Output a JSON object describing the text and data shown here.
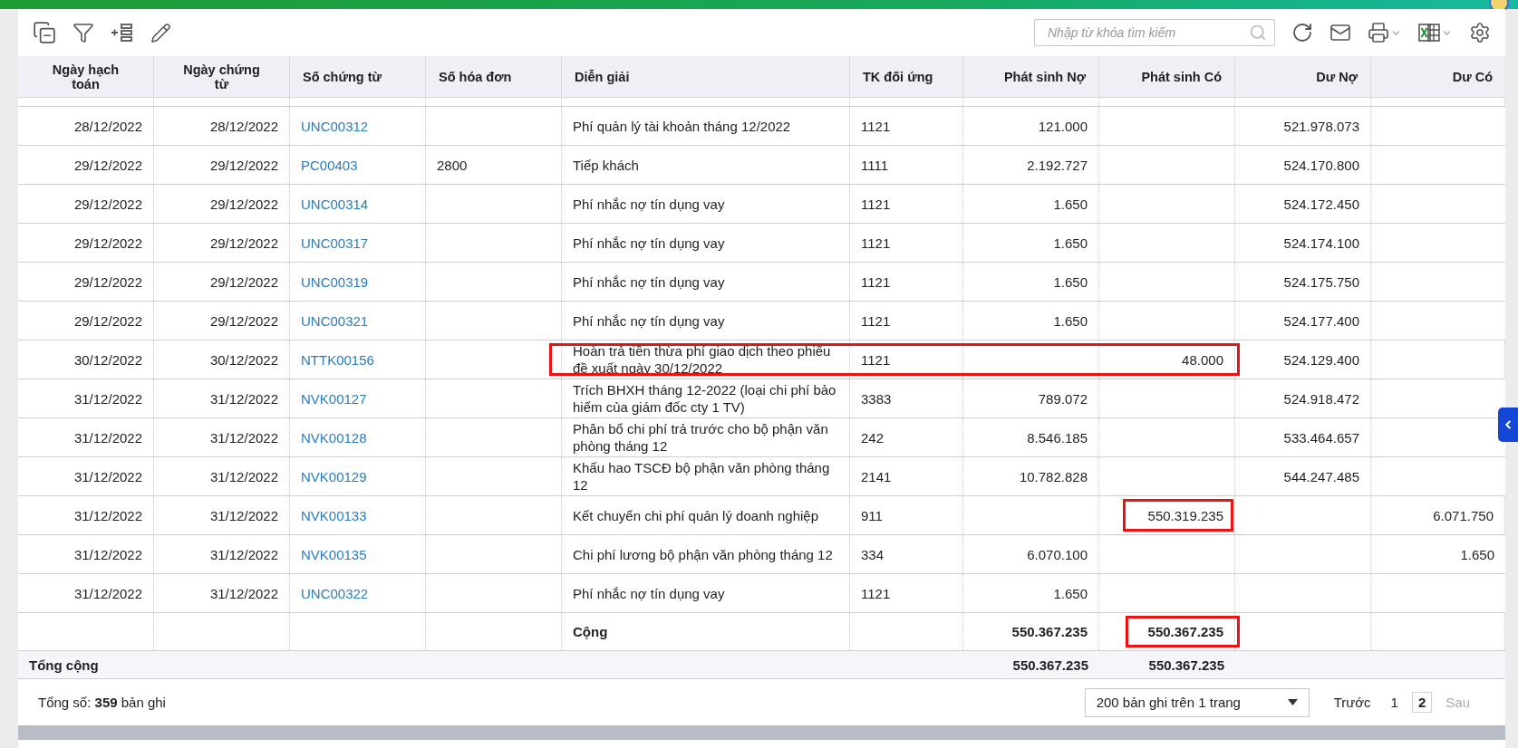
{
  "toolbar": {
    "search": {
      "placeholder": "Nhập từ khóa tìm kiếm"
    }
  },
  "table": {
    "columns": [
      "Ngày hạch toán",
      "Ngày chứng từ",
      "Số chứng từ",
      "Số hóa đơn",
      "Diễn giải",
      "TK đối ứng",
      "Phát sinh Nợ",
      "Phát sinh Có",
      "Dư Nợ",
      "Dư Có"
    ],
    "rows": [
      {
        "posting_date": "28/12/2022",
        "voucher_date": "28/12/2022",
        "voucher_no": "UNC00312",
        "invoice_no": "",
        "description": "Phí quản lý tài khoản tháng 12/2022",
        "account": "1121",
        "debit": "121.000",
        "credit": "",
        "debit_balance": "521.978.073",
        "credit_balance": "",
        "span_outlined": false,
        "credit_outlined": false
      },
      {
        "posting_date": "29/12/2022",
        "voucher_date": "29/12/2022",
        "voucher_no": "PC00403",
        "invoice_no": "2800",
        "description": "Tiếp khách",
        "account": "1111",
        "debit": "2.192.727",
        "credit": "",
        "debit_balance": "524.170.800",
        "credit_balance": "",
        "span_outlined": false,
        "credit_outlined": false
      },
      {
        "posting_date": "29/12/2022",
        "voucher_date": "29/12/2022",
        "voucher_no": "UNC00314",
        "invoice_no": "",
        "description": "Phí nhắc nợ tín dụng vay",
        "account": "1121",
        "debit": "1.650",
        "credit": "",
        "debit_balance": "524.172.450",
        "credit_balance": "",
        "span_outlined": false,
        "credit_outlined": false
      },
      {
        "posting_date": "29/12/2022",
        "voucher_date": "29/12/2022",
        "voucher_no": "UNC00317",
        "invoice_no": "",
        "description": "Phí nhắc nợ tín dụng vay",
        "account": "1121",
        "debit": "1.650",
        "credit": "",
        "debit_balance": "524.174.100",
        "credit_balance": "",
        "span_outlined": false,
        "credit_outlined": false
      },
      {
        "posting_date": "29/12/2022",
        "voucher_date": "29/12/2022",
        "voucher_no": "UNC00319",
        "invoice_no": "",
        "description": "Phí nhắc nợ tín dụng vay",
        "account": "1121",
        "debit": "1.650",
        "credit": "",
        "debit_balance": "524.175.750",
        "credit_balance": "",
        "span_outlined": false,
        "credit_outlined": false
      },
      {
        "posting_date": "29/12/2022",
        "voucher_date": "29/12/2022",
        "voucher_no": "UNC00321",
        "invoice_no": "",
        "description": "Phí nhắc nợ tín dụng vay",
        "account": "1121",
        "debit": "1.650",
        "credit": "",
        "debit_balance": "524.177.400",
        "credit_balance": "",
        "span_outlined": false,
        "credit_outlined": false
      },
      {
        "posting_date": "30/12/2022",
        "voucher_date": "30/12/2022",
        "voucher_no": "NTTK00156",
        "invoice_no": "",
        "description": "Hoàn trả tiền thừa phí giao dịch theo phiếu đề xuất ngày 30/12/2022",
        "account": "1121",
        "debit": "",
        "credit": "48.000",
        "debit_balance": "524.129.400",
        "credit_balance": "",
        "span_outlined": true,
        "credit_outlined": false
      },
      {
        "posting_date": "31/12/2022",
        "voucher_date": "31/12/2022",
        "voucher_no": "NVK00127",
        "invoice_no": "",
        "description": "Trích BHXH tháng 12-2022 (loại chi phí bảo hiểm của giám đốc cty 1 TV)",
        "account": "3383",
        "debit": "789.072",
        "credit": "",
        "debit_balance": "524.918.472",
        "credit_balance": "",
        "span_outlined": false,
        "credit_outlined": false
      },
      {
        "posting_date": "31/12/2022",
        "voucher_date": "31/12/2022",
        "voucher_no": "NVK00128",
        "invoice_no": "",
        "description": "Phân bổ chi phí trả trước cho bộ phận văn phòng tháng 12",
        "account": "242",
        "debit": "8.546.185",
        "credit": "",
        "debit_balance": "533.464.657",
        "credit_balance": "",
        "span_outlined": false,
        "credit_outlined": false
      },
      {
        "posting_date": "31/12/2022",
        "voucher_date": "31/12/2022",
        "voucher_no": "NVK00129",
        "invoice_no": "",
        "description": "Khấu hao TSCĐ bộ phận văn phòng tháng 12",
        "account": "2141",
        "debit": "10.782.828",
        "credit": "",
        "debit_balance": "544.247.485",
        "credit_balance": "",
        "span_outlined": false,
        "credit_outlined": false
      },
      {
        "posting_date": "31/12/2022",
        "voucher_date": "31/12/2022",
        "voucher_no": "NVK00133",
        "invoice_no": "",
        "description": "Kết chuyển chi phí quản lý doanh nghiệp",
        "account": "911",
        "debit": "",
        "credit": "550.319.235",
        "debit_balance": "",
        "credit_balance": "6.071.750",
        "span_outlined": false,
        "credit_outlined": true
      },
      {
        "posting_date": "31/12/2022",
        "voucher_date": "31/12/2022",
        "voucher_no": "NVK00135",
        "invoice_no": "",
        "description": "Chi phí lương bộ phận văn phòng tháng 12",
        "account": "334",
        "debit": "6.070.100",
        "credit": "",
        "debit_balance": "",
        "credit_balance": "1.650",
        "span_outlined": false,
        "credit_outlined": false
      },
      {
        "posting_date": "31/12/2022",
        "voucher_date": "31/12/2022",
        "voucher_no": "UNC00322",
        "invoice_no": "",
        "description": "Phí nhắc nợ tín dụng vay",
        "account": "1121",
        "debit": "1.650",
        "credit": "",
        "debit_balance": "",
        "credit_balance": "",
        "span_outlined": false,
        "credit_outlined": false
      }
    ],
    "subtotal": {
      "label": "Cộng",
      "debit": "550.367.235",
      "credit": "550.367.235",
      "credit_outlined": true
    },
    "grand_total": {
      "label": "Tổng cộng",
      "debit": "550.367.235",
      "credit": "550.367.235"
    }
  },
  "footer": {
    "total_label": "Tổng số:",
    "total_count": "359",
    "total_unit": "bản ghi",
    "page_size": "200 bản ghi trên 1 trang",
    "prev": "Trước",
    "pages": [
      {
        "label": "1",
        "selected": false
      },
      {
        "label": "2",
        "selected": true
      }
    ],
    "next": "Sau",
    "next_disabled": true
  }
}
